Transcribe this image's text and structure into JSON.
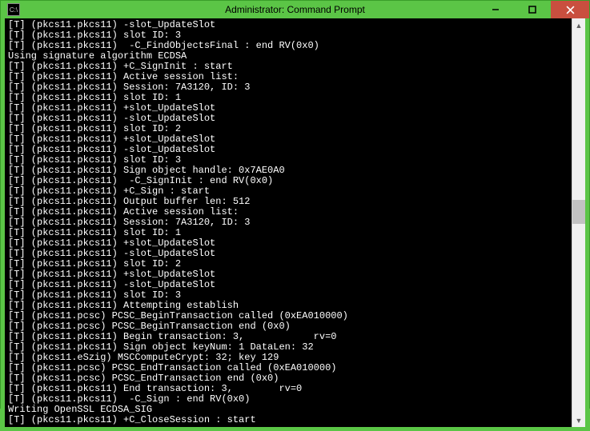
{
  "window": {
    "title": "Administrator: Command Prompt"
  },
  "terminal": {
    "lines": [
      "[T] (pkcs11.pkcs11) -slot_UpdateSlot",
      "[T] (pkcs11.pkcs11) slot ID: 3",
      "[T] (pkcs11.pkcs11)  -C_FindObjectsFinal : end RV(0x0)",
      "Using signature algorithm ECDSA",
      "[T] (pkcs11.pkcs11) +C_SignInit : start",
      "[T] (pkcs11.pkcs11) Active session list:",
      "[T] (pkcs11.pkcs11) Session: 7A3120, ID: 3",
      "[T] (pkcs11.pkcs11) slot ID: 1",
      "[T] (pkcs11.pkcs11) +slot_UpdateSlot",
      "[T] (pkcs11.pkcs11) -slot_UpdateSlot",
      "[T] (pkcs11.pkcs11) slot ID: 2",
      "[T] (pkcs11.pkcs11) +slot_UpdateSlot",
      "[T] (pkcs11.pkcs11) -slot_UpdateSlot",
      "[T] (pkcs11.pkcs11) slot ID: 3",
      "[T] (pkcs11.pkcs11) Sign object handle: 0x7AE0A0",
      "[T] (pkcs11.pkcs11)  -C_SignInit : end RV(0x0)",
      "[T] (pkcs11.pkcs11) +C_Sign : start",
      "[T] (pkcs11.pkcs11) Output buffer len: 512",
      "[T] (pkcs11.pkcs11) Active session list:",
      "[T] (pkcs11.pkcs11) Session: 7A3120, ID: 3",
      "[T] (pkcs11.pkcs11) slot ID: 1",
      "[T] (pkcs11.pkcs11) +slot_UpdateSlot",
      "[T] (pkcs11.pkcs11) -slot_UpdateSlot",
      "[T] (pkcs11.pkcs11) slot ID: 2",
      "[T] (pkcs11.pkcs11) +slot_UpdateSlot",
      "[T] (pkcs11.pkcs11) -slot_UpdateSlot",
      "[T] (pkcs11.pkcs11) slot ID: 3",
      "[T] (pkcs11.pkcs11) Attempting establish",
      "[T] (pkcs11.pcsc) PCSC_BeginTransaction called (0xEA010000)",
      "[T] (pkcs11.pcsc) PCSC_BeginTransaction end (0x0)",
      "[T] (pkcs11.pkcs11) Begin transaction: 3,            rv=0",
      "[T] (pkcs11.pkcs11) Sign object keyNum: 1 DataLen: 32",
      "[T] (pkcs11.eSzig) MSCComputeCrypt: 32; key 129",
      "[T] (pkcs11.pcsc) PCSC_EndTransaction called (0xEA010000)",
      "[T] (pkcs11.pcsc) PCSC_EndTransaction end (0x0)",
      "[T] (pkcs11.pkcs11) End transaction: 3,        rv=0",
      "[T] (pkcs11.pkcs11)  -C_Sign : end RV(0x0)",
      "Writing OpenSSL ECDSA_SIG",
      "[T] (pkcs11.pkcs11) +C_CloseSession : start"
    ]
  }
}
